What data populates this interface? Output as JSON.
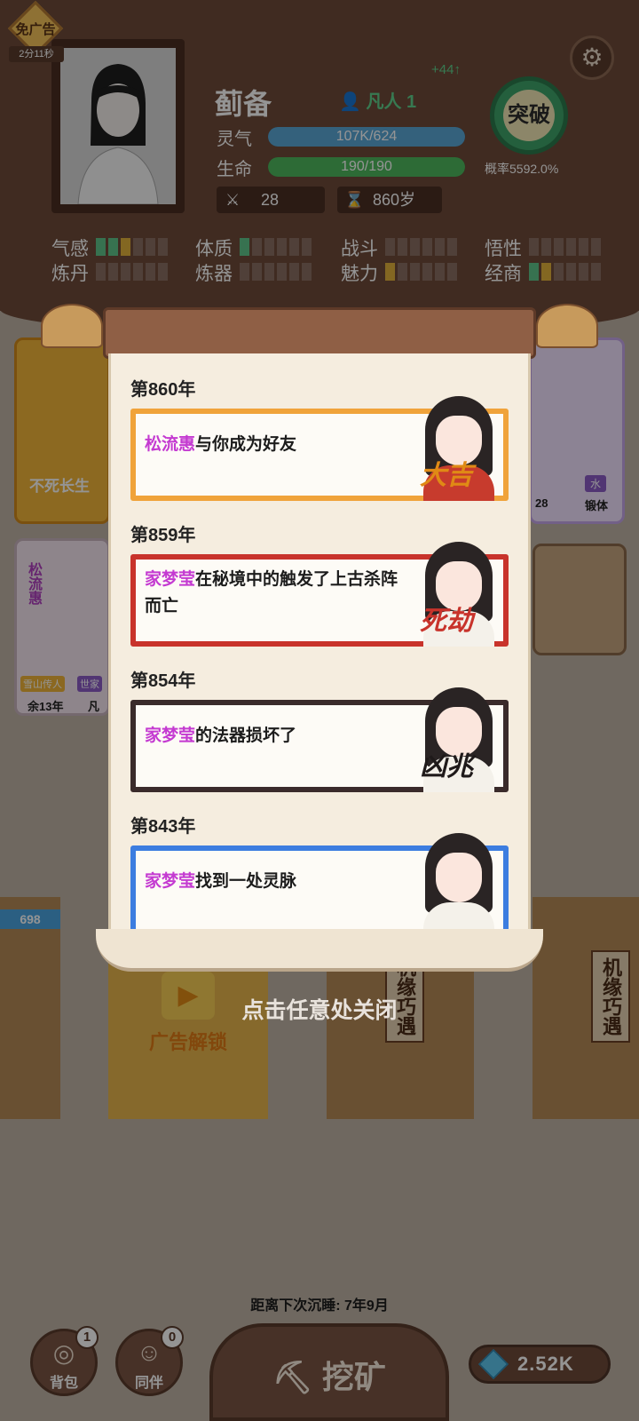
{
  "ad_badge": {
    "label": "免广告",
    "timer": "2分11秒"
  },
  "character": {
    "name": "蓟备",
    "rank": "凡人 1",
    "rank_gain": "+44↑",
    "spirit_label": "灵气",
    "spirit_value": "107K/624",
    "life_label": "生命",
    "life_value": "190/190",
    "power": "28",
    "age": "860岁"
  },
  "breakthrough": {
    "label": "突破",
    "rate": "概率5592.0%"
  },
  "attributes": [
    {
      "name": "气感",
      "green": 2,
      "yellow": 1
    },
    {
      "name": "体质",
      "green": 1,
      "yellow": 0
    },
    {
      "name": "战斗",
      "green": 0,
      "yellow": 0
    },
    {
      "name": "悟性",
      "green": 0,
      "yellow": 0
    },
    {
      "name": "炼丹",
      "green": 0,
      "yellow": 0
    },
    {
      "name": "炼器",
      "green": 0,
      "yellow": 0
    },
    {
      "name": "魅力",
      "green": 0,
      "yellow": 1
    },
    {
      "name": "经商",
      "green": 1,
      "yellow": 1
    }
  ],
  "background": {
    "left_card_label": "不死长生",
    "companion_name": "松流惠",
    "companion_tag1": "雪山传人",
    "companion_tag2": "世家",
    "companion_years": "余13年",
    "companion_rank": "凡",
    "right_card_tag1": "水",
    "right_card_count": "28",
    "right_card_label": "锻体",
    "gem_ribbon": "698",
    "ad_unlock": "广告解锁",
    "ticket_label": "机缘巧遇"
  },
  "log": [
    {
      "year": "第860年",
      "who": "松流惠",
      "text": "与你成为好友",
      "tag": "大吉",
      "border": "#f0a33a",
      "tag_color": "#e08a15",
      "dress": "#c73b2d"
    },
    {
      "year": "第859年",
      "who": "家梦莹",
      "text": "在秘境中的触发了上古杀阵而亡",
      "tag": "死劫",
      "border": "#c8332b",
      "tag_color": "#c8332b",
      "dress": "#f4f1ea"
    },
    {
      "year": "第854年",
      "who": "家梦莹",
      "text": "的法器损坏了",
      "tag": "凶兆",
      "border": "#3a2b2b",
      "tag_color": "#1f1a1a",
      "dress": "#f4f1ea"
    },
    {
      "year": "第843年",
      "who": "家梦莹",
      "text": "找到一处灵脉",
      "tag": "",
      "border": "#3c7de0",
      "tag_color": "#3c7de0",
      "dress": "#f4f1ea"
    }
  ],
  "close_hint": "点击任意处关闭",
  "footer": {
    "sleep_text": "距离下次沉睡: 7年9月",
    "bag_label": "背包",
    "bag_count": "1",
    "partner_label": "同伴",
    "partner_count": "0",
    "dig_label": "挖矿",
    "gems": "2.52K"
  }
}
